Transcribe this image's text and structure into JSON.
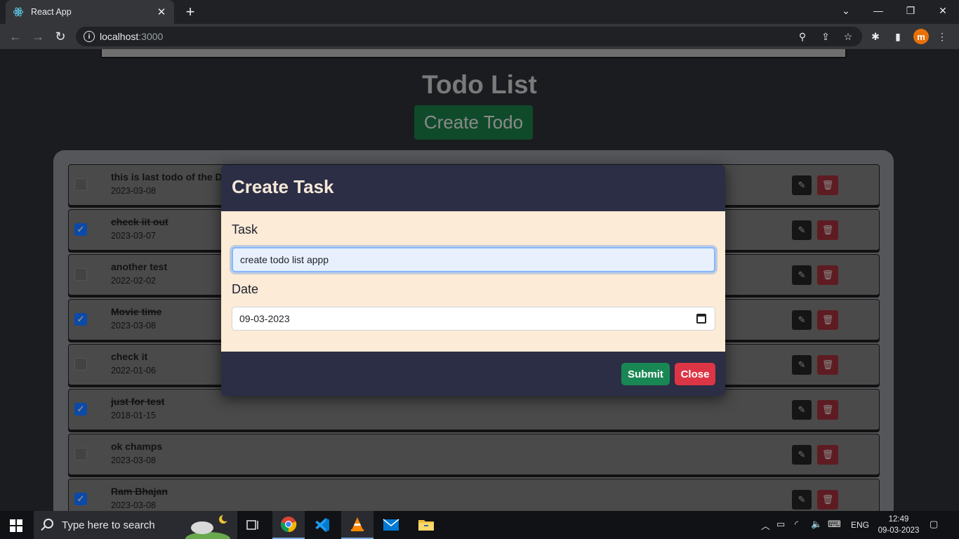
{
  "browser": {
    "tab_title": "React App",
    "tab_close": "✕",
    "new_tab": "+",
    "url_host": "localhost",
    "url_port": ":3000",
    "profile_initial": "m"
  },
  "page": {
    "title": "Todo List",
    "create_button": "Create Todo"
  },
  "todos": [
    {
      "text": "this is last todo of the D",
      "date": "2023-03-08",
      "done": false
    },
    {
      "text": "check iit out",
      "date": "2023-03-07",
      "done": true
    },
    {
      "text": "another test",
      "date": "2022-02-02",
      "done": false
    },
    {
      "text": "Movie time",
      "date": "2023-03-08",
      "done": true
    },
    {
      "text": "check it",
      "date": "2022-01-06",
      "done": false
    },
    {
      "text": "just for test",
      "date": "2018-01-15",
      "done": true
    },
    {
      "text": "ok champs",
      "date": "2023-03-08",
      "done": false
    },
    {
      "text": "Ram Bhajan",
      "date": "2023-03-08",
      "done": true
    }
  ],
  "modal": {
    "title": "Create Task",
    "task_label": "Task",
    "task_value": "create todo list appp",
    "date_label": "Date",
    "date_value": "09-03-2023",
    "submit_label": "Submit",
    "close_label": "Close"
  },
  "taskbar": {
    "search_placeholder": "Type here to search",
    "language": "ENG",
    "time": "12:49",
    "date": "09-03-2023"
  }
}
